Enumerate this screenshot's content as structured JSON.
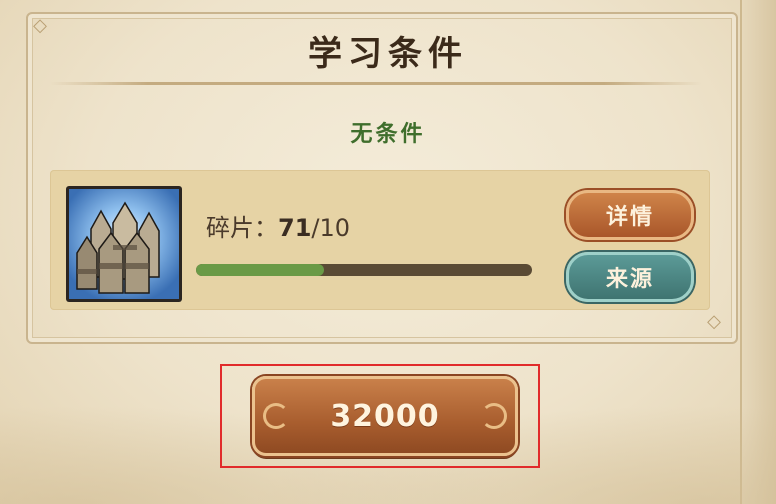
{
  "title": "学习条件",
  "condition_text": "无条件",
  "item": {
    "shard_label": "碎片：",
    "shard_count": "71",
    "shard_sep": "/",
    "shard_required": "10",
    "progress_fraction": 0.38,
    "icon": "stone-pillars-icon"
  },
  "buttons": {
    "detail_label": "详情",
    "source_label": "来源",
    "cost_value": "32000"
  },
  "colors": {
    "condition_green": "#3f6e2c",
    "detail_button": "#b8653a",
    "source_button": "#4e8683",
    "cost_button": "#a85d2e",
    "highlight_red": "#e12b2b",
    "progress_fill": "#6a9a46"
  }
}
